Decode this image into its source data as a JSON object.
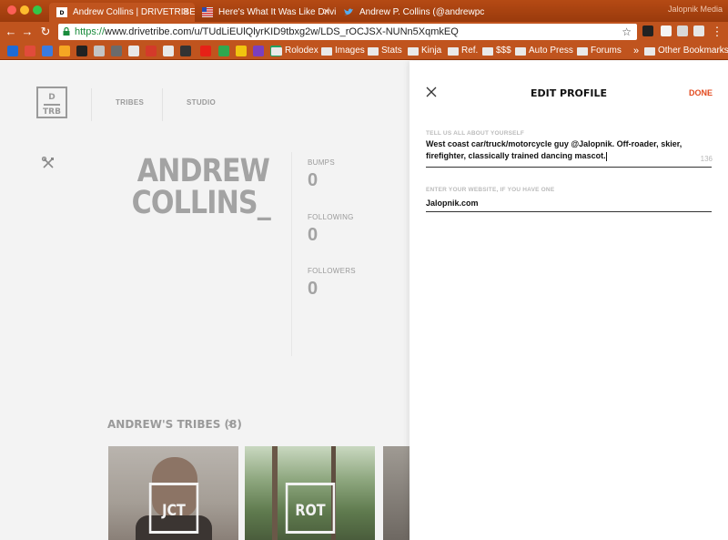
{
  "browser": {
    "tabs": [
      {
        "title": "Andrew Collins | DRIVETRIBE",
        "active": true
      },
      {
        "title": "Here's What It Was Like Drivi",
        "active": false
      },
      {
        "title": "Andrew P. Collins (@andrewpc",
        "active": false
      }
    ],
    "profile_name": "Jalopnik Media",
    "url_scheme": "https://",
    "url_rest": "www.drivetribe.com/u/TUdLiEUlQlyrKID9tbxg2w/LDS_rOCJSX-NUNn5XqmkEQ",
    "bookmarks": [
      "Rolodex",
      "Images",
      "Stats",
      "Kinja",
      "Ref.",
      "$$$",
      "Auto Press",
      "Forums"
    ],
    "other_bookmarks": "Other Bookmarks",
    "bookmark_chevron": "»",
    "colors": {
      "chrome": "#c0541e",
      "accent": "#e24a1f"
    }
  },
  "site": {
    "logo_top": "D",
    "logo_bottom": "TRB",
    "nav": [
      "TRIBES",
      "STUDIO"
    ]
  },
  "profile": {
    "name_line1": "ANDREW",
    "name_line2": "COLLINS_",
    "stats": [
      {
        "label": "BUMPS",
        "value": "0"
      },
      {
        "label": "FOLLOWING",
        "value": "0"
      },
      {
        "label": "FOLLOWERS",
        "value": "0"
      }
    ],
    "tribes_heading": "ANDREW'S TRIBES (8)",
    "tribes": [
      {
        "badge": "JCT"
      },
      {
        "badge": "ROT"
      },
      {
        "badge": ""
      }
    ]
  },
  "edit_panel": {
    "title": "EDIT PROFILE",
    "done_label": "DONE",
    "bio_label": "TELL US ALL ABOUT YOURSELF",
    "bio_line1": "West coast car/truck/motorcycle guy @Jalopnik. Off-roader, skier,",
    "bio_line2": "firefighter, classically trained dancing mascot.",
    "bio_remaining": "136",
    "website_label": "ENTER YOUR WEBSITE, IF YOU HAVE ONE",
    "website_value": "Jalopnik.com"
  }
}
